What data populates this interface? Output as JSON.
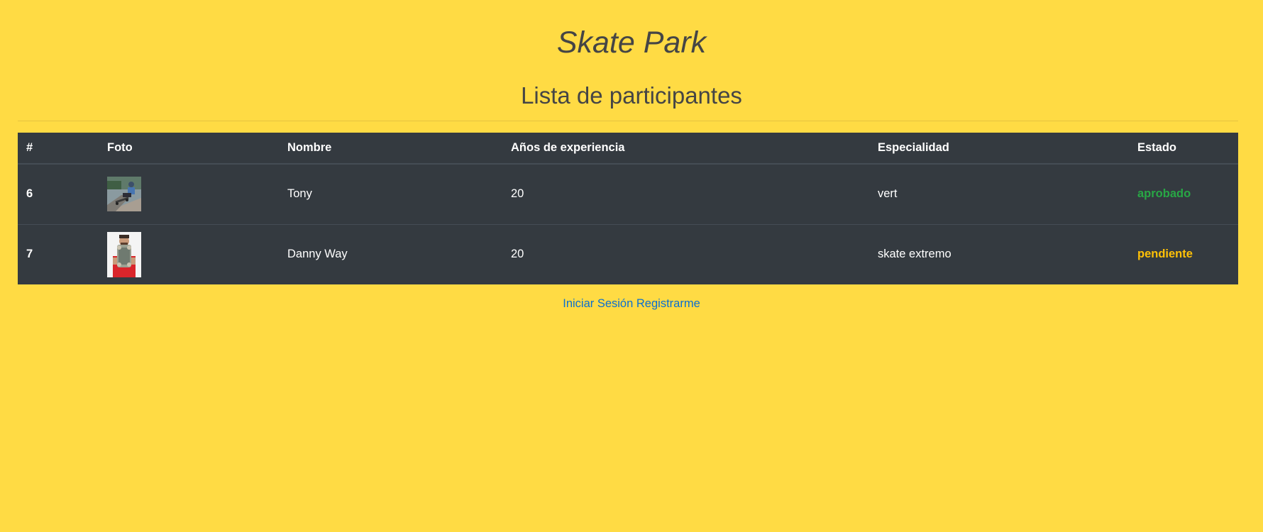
{
  "site": {
    "title": "Skate Park"
  },
  "page": {
    "heading": "Lista de participantes"
  },
  "table": {
    "headers": [
      "#",
      "Foto",
      "Nombre",
      "Años de experiencia",
      "Especialidad",
      "Estado"
    ],
    "rows": [
      {
        "id": "6",
        "photo": "skater-photo-tony",
        "name": "Tony",
        "years": "20",
        "specialty": "vert",
        "status": "aprobado",
        "status_color": "#28a745"
      },
      {
        "id": "7",
        "photo": "skater-photo-danny-way",
        "name": "Danny Way",
        "years": "20",
        "specialty": "skate extremo",
        "status": "pendiente",
        "status_color": "#ffc107"
      }
    ]
  },
  "footer": {
    "login_label": "Iniciar Sesión",
    "register_label": "Registrarme"
  },
  "colors": {
    "background": "#ffdb44",
    "table_background": "#343a40",
    "link": "#0a6fd0"
  }
}
